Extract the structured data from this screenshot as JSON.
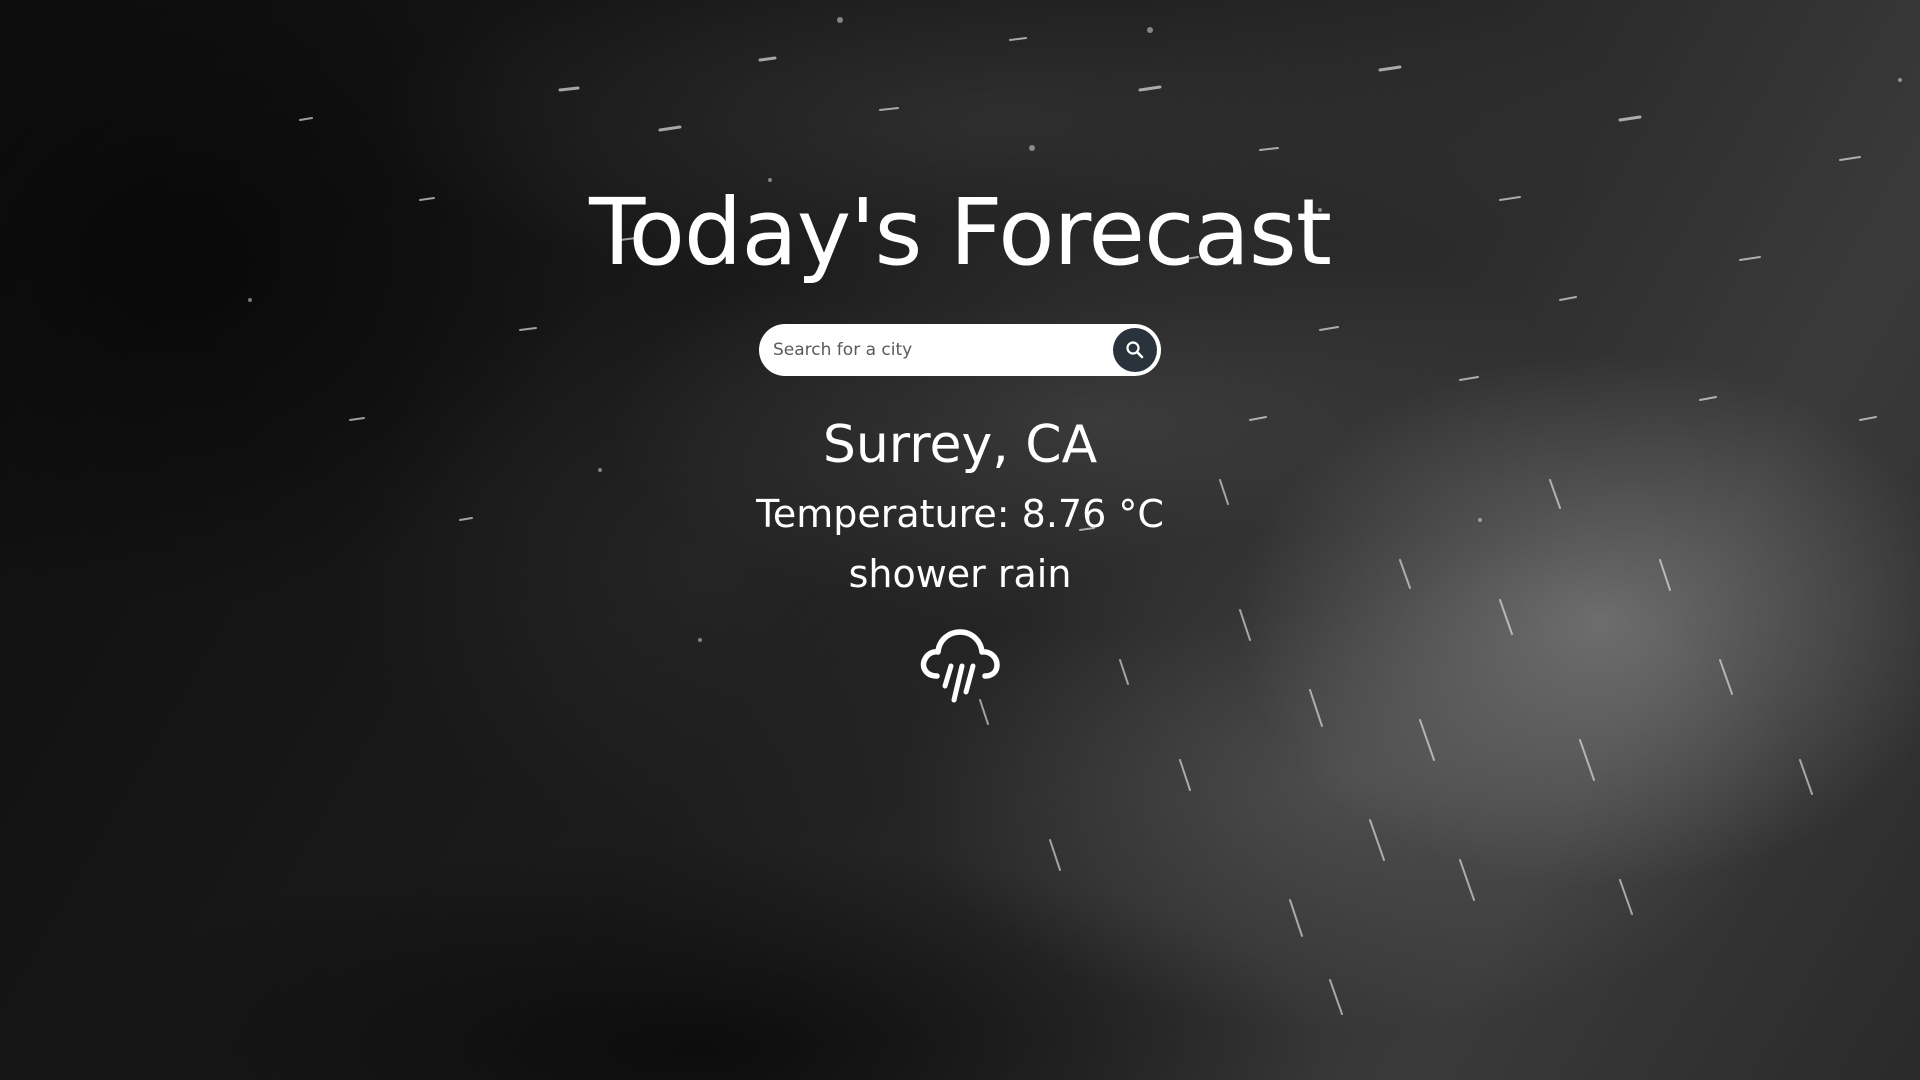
{
  "header": {
    "title": "Today's Forecast"
  },
  "search": {
    "placeholder": "Search for a city",
    "value": "",
    "button_icon": "search-icon"
  },
  "weather": {
    "city": "Surrey, CA",
    "temperature": "Temperature: 8.76 °C",
    "description": "shower rain",
    "icon": "cloud-rain-icon"
  },
  "colors": {
    "text": "#ffffff",
    "search_background": "#ffffff",
    "search_button": "#2a323c",
    "page_background": "#141414"
  }
}
